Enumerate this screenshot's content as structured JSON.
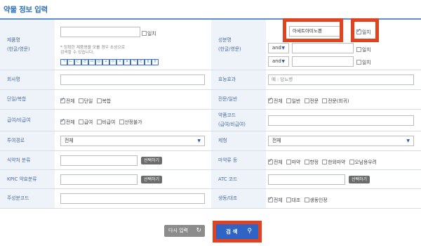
{
  "page_title": "약물 정보 입력",
  "labels": {
    "product_name": "제품명\n(한글/영문)",
    "ingredient": "성분명\n(한글/영문)",
    "company": "회사명",
    "efficacy": "효능효과",
    "single_combo": "단일/복합",
    "professional_general": "전문/일반",
    "payment": "급여/비급여",
    "drug_code": "약품코드\n(급여/비급여)",
    "route": "투여경로",
    "form": "제형",
    "mfds_class": "식약처 분류",
    "narcotic": "마약류 등",
    "kpic_class": "KPIC 약효분류",
    "atc_code": "ATC 코드",
    "main_code": "주성분코드",
    "bio_equiv": "생동/대조"
  },
  "product_exact": "일치",
  "product_hint": "* 정확한 제품명을 모를 경우 초성으로\n  검색할 수 있습니다.",
  "jamo": [
    "ㄱ",
    "ㄴ",
    "ㄷ",
    "ㄹ",
    "ㅁ",
    "ㅂ",
    "ㅅ",
    "ㅇ",
    "ㅈ",
    "ㅊ",
    "ㅋ",
    "ㅌ",
    "ㅍ",
    "ㅎ"
  ],
  "ingredient_value": "아세트아미노펜",
  "ingredient_exact": "일치",
  "and_label": "and",
  "exact2": "일치",
  "exact3": "일치",
  "efficacy_placeholder": "예 : 당뇨병",
  "single_combo_opts": [
    "전체",
    "단일",
    "복합"
  ],
  "prof_opts": [
    "전체",
    "일반",
    "전문",
    "전문(희귀)"
  ],
  "payment_opts": [
    "전체",
    "급여",
    "비급여",
    "산정불가"
  ],
  "route_value": "전체",
  "form_value": "전체",
  "select_btn": "선택하기",
  "narcotic_opts": [
    "전체",
    "마약",
    "향정",
    "한외마약",
    "오남용우려"
  ],
  "bio_opts": [
    "전체",
    "대조",
    "생동인정"
  ],
  "reset_label": "다시 입력",
  "search_label": "검 색",
  "colors": {
    "accent": "#2c6fb7",
    "highlight": "#e1421f",
    "search_btn": "#2f64c4"
  }
}
